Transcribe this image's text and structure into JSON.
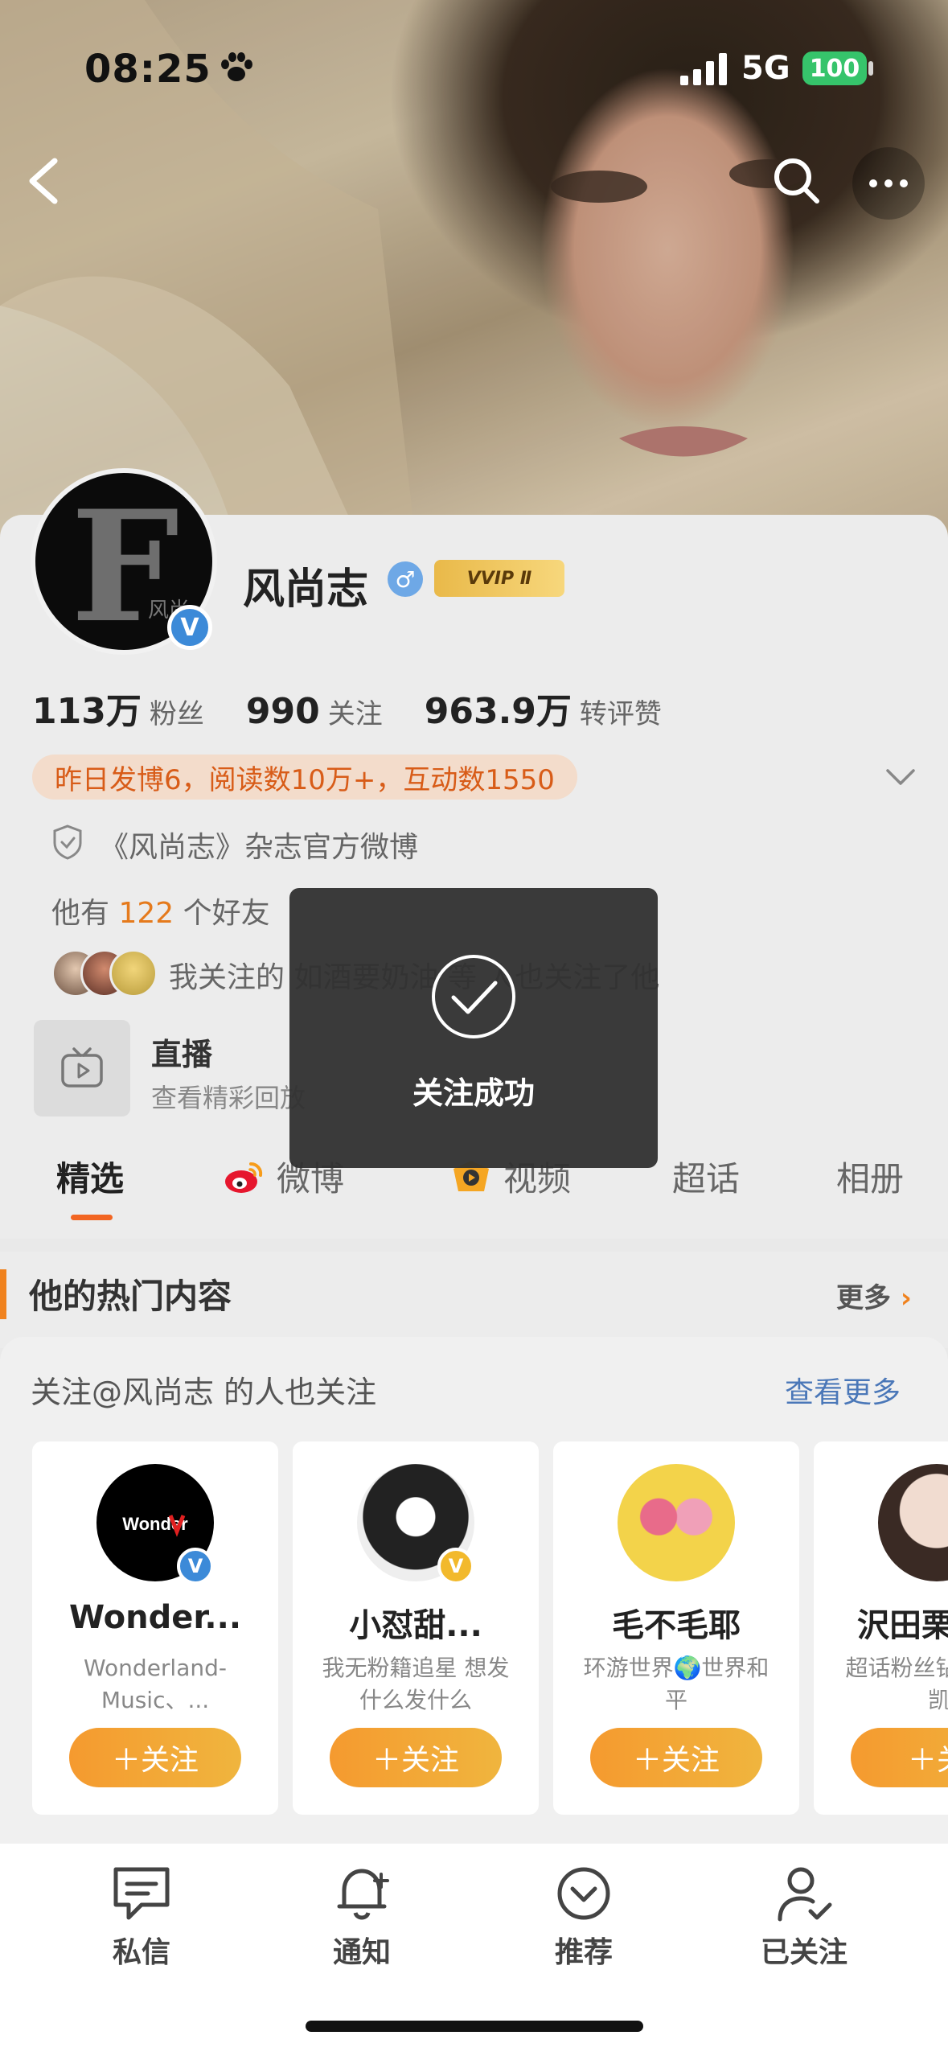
{
  "status": {
    "time": "08:25",
    "network": "5G",
    "battery": "100"
  },
  "profile": {
    "name": "风尚志",
    "vvip": "VVIP Ⅱ",
    "stats": [
      {
        "value": "113万",
        "label": "粉丝"
      },
      {
        "value": "990",
        "label": "关注"
      },
      {
        "value": "963.9万",
        "label": "转评赞"
      }
    ],
    "activity": "昨日发博6，阅读数10万+，互动数1550",
    "bio": "《风尚志》杂志官方微博",
    "friends_prefix": "他有",
    "friends_count": "122",
    "friends_suffix": "个好友",
    "mutual": "我关注的 如酒要奶油 等 人也关注了他",
    "live_title": "直播",
    "live_sub": "查看精彩回放"
  },
  "tabs": [
    "精选",
    "微博",
    "视频",
    "超话",
    "相册"
  ],
  "hot": {
    "title": "他的热门内容",
    "more": "更多"
  },
  "toast": {
    "text": "关注成功"
  },
  "suggest": {
    "title": "关注@风尚志 的人也关注",
    "more": "查看更多",
    "cards": [
      {
        "name": "Wonder...",
        "desc": "Wonderland-Music、...",
        "follow": "＋关注",
        "badge": "blue"
      },
      {
        "name": "小怼甜...",
        "desc": "我无粉籍追星 想发什么发什么",
        "follow": "＋关注",
        "badge": "yellow"
      },
      {
        "name": "毛不毛耶",
        "desc": "环游世界🌍世界和平",
        "follow": "＋关注",
        "badge": ""
      },
      {
        "name": "沢田栗",
        "desc": "超话粉丝钻 鬼王琳凯",
        "follow": "＋关",
        "badge": ""
      }
    ]
  },
  "bottom": [
    "私信",
    "通知",
    "推荐",
    "已关注"
  ],
  "colors": {
    "accent": "#f26522",
    "follow": "#f59a2f",
    "link": "#4a77b8"
  }
}
